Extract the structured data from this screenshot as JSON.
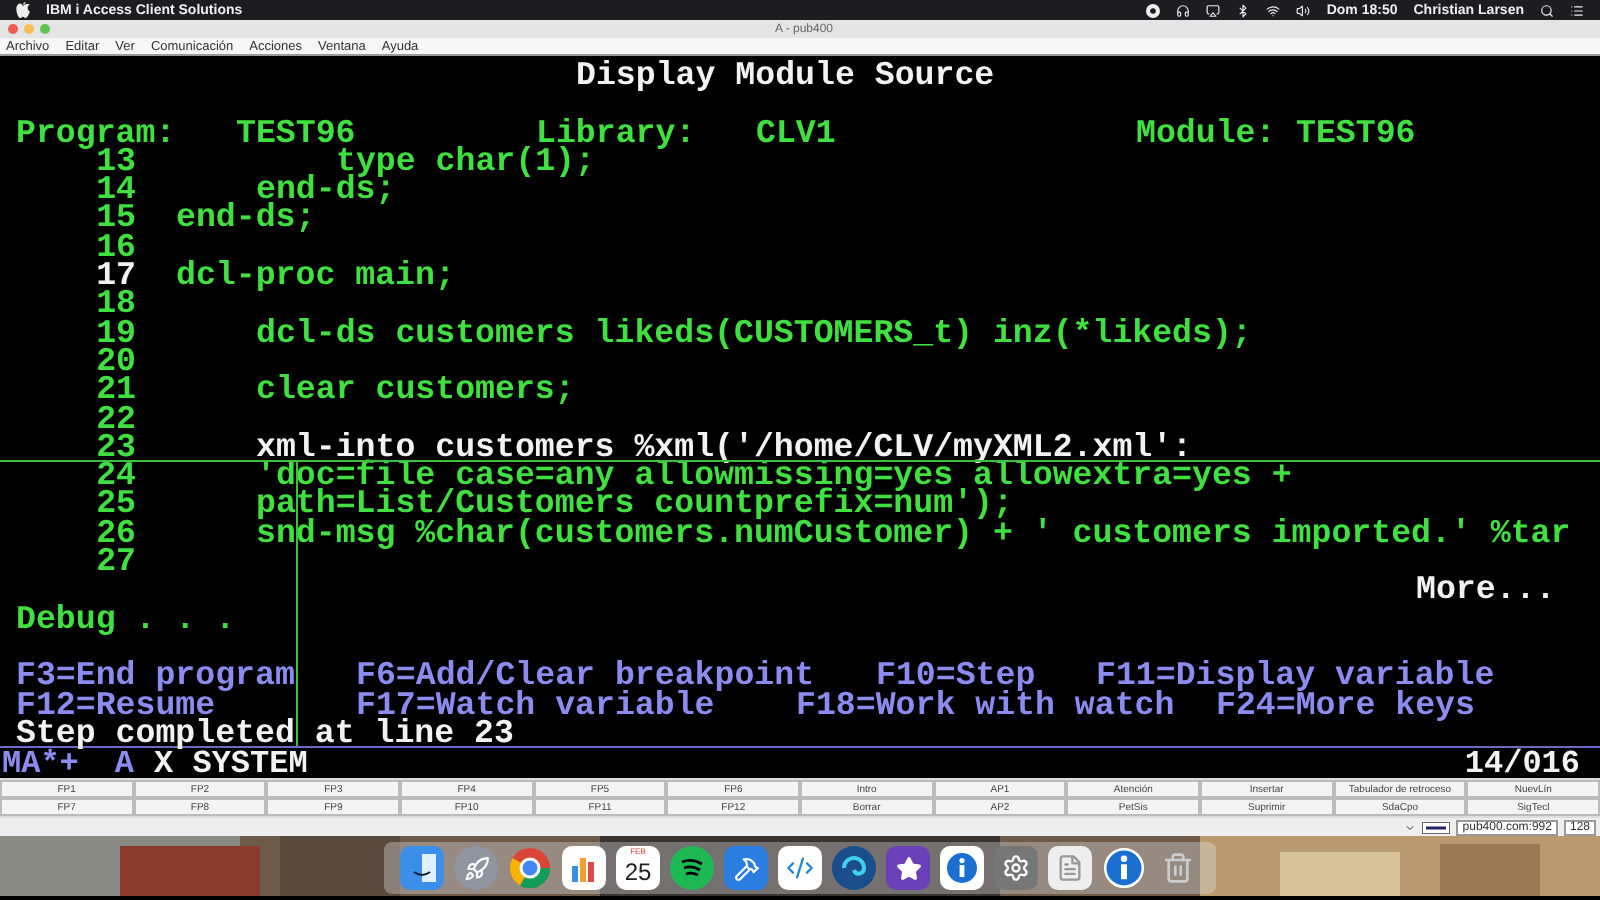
{
  "mac_menu_bar": {
    "app_name": "IBM i Access Client Solutions",
    "clock": "Dom 18:50",
    "user": "Christian Larsen"
  },
  "window": {
    "title": "A - pub400"
  },
  "menu": [
    "Archivo",
    "Editar",
    "Ver",
    "Comunicación",
    "Acciones",
    "Ventana",
    "Ayuda"
  ],
  "terminal": {
    "title": "Display Module Source",
    "header": [
      {
        "label": "Program:",
        "value": "TEST96"
      },
      {
        "label": "Library:",
        "value": "CLV1"
      },
      {
        "label": "Module:",
        "value": "TEST96"
      }
    ],
    "lines": [
      {
        "number": "13",
        "code": "        type char(1);",
        "current": false,
        "number_highlighted": false
      },
      {
        "number": "14",
        "code": "    end-ds;",
        "current": false,
        "number_highlighted": false
      },
      {
        "number": "15",
        "code": "end-ds;",
        "current": false,
        "number_highlighted": false
      },
      {
        "number": "16",
        "number_highlighted": false
      },
      {
        "number": "17",
        "code": "dcl-proc main;",
        "current": false,
        "number_highlighted": true
      },
      {
        "number": "18",
        "number_highlighted": false
      },
      {
        "number": "19",
        "code": "    dcl-ds customers likeds(CUSTOMERS_t) inz(*likeds);",
        "current": false,
        "number_highlighted": false
      },
      {
        "number": "20",
        "number_highlighted": false
      },
      {
        "number": "21",
        "code": "    clear customers;",
        "current": false,
        "number_highlighted": false
      },
      {
        "number": "22",
        "number_highlighted": false
      },
      {
        "number": "23",
        "code": "    xml-into customers %xml('/home/CLV/myXML2.xml':",
        "current": true,
        "number_highlighted": false
      },
      {
        "number": "24",
        "code": "    'doc=file case=any allowmissing=yes allowextra=yes +",
        "current": false,
        "number_highlighted": false
      },
      {
        "number": "25",
        "code": "    path=List/Customers countprefix=num');",
        "current": false,
        "number_highlighted": false
      },
      {
        "number": "26",
        "code": "    snd-msg %char(customers.numCustomer) + ' customers imported.' %tar",
        "current": false,
        "number_highlighted": false
      },
      {
        "number": "27",
        "number_highlighted": false
      }
    ],
    "more": "More...",
    "prompt": "Debug . . .",
    "function_keys": [
      [
        "F3=End program",
        "F6=Add/Clear breakpoint",
        "F10=Step",
        "F11=Display variable"
      ],
      [
        "F12=Resume",
        "F17=Watch variable",
        "F18=Work with watch",
        "F24=More keys"
      ]
    ],
    "message": "Step completed at line 23"
  },
  "status_line": {
    "indicator": "MA*+",
    "session": "A",
    "system": "X SYSTEM",
    "position": "14/016"
  },
  "keypad": [
    [
      "FP1",
      "FP2",
      "FP3",
      "FP4",
      "FP5",
      "FP6",
      "Intro",
      "AP1",
      "Atención",
      "Insertar",
      "Tabulador de retroceso",
      "NuevLín"
    ],
    [
      "FP7",
      "FP8",
      "FP9",
      "FP10",
      "FP11",
      "FP12",
      "Borrar",
      "AP2",
      "PetSis",
      "Suprimir",
      "SdaCpo",
      "SigTecl"
    ]
  ],
  "status_bar": {
    "host": "pub400.com:992",
    "extra": "128"
  },
  "dock": {
    "calendar_month": "FEB",
    "calendar_day": "25"
  }
}
